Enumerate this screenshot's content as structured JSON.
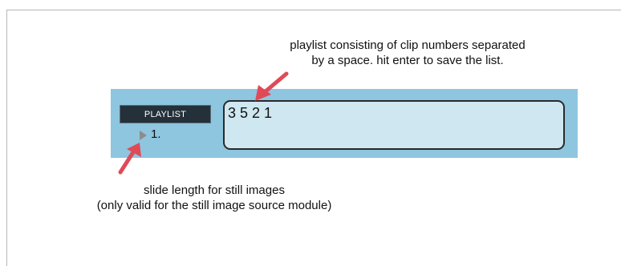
{
  "annotations": {
    "top_line1": "playlist consisting of clip numbers separated",
    "top_line2": "by a space. hit enter to save the list.",
    "bottom_line1": "slide length for still images",
    "bottom_line2": "(only valid for the still image source module)"
  },
  "panel": {
    "playlist_button_label": "PLAYLIST",
    "slide_length_value": "1.",
    "playlist_value": "3 5 2 1"
  },
  "colors": {
    "panel_bg": "#8ec5df",
    "input_bg": "#cfe7f1",
    "button_bg": "#24313a",
    "arrow": "#e04a57"
  }
}
